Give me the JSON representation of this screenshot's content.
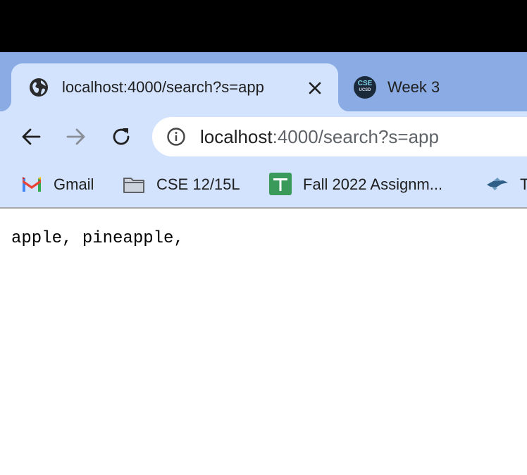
{
  "browser": {
    "tabs": [
      {
        "title": "localhost:4000/search?s=app",
        "active": true,
        "favicon": "globe-icon"
      },
      {
        "title": "Week 3",
        "active": false,
        "favicon_text_top": "CSE",
        "favicon_text_bottom": "UCSD"
      }
    ],
    "toolbar": {
      "url_host": "localhost",
      "url_rest": ":4000/search?s=app"
    },
    "bookmarks": [
      {
        "label": "Gmail",
        "icon": "gmail-icon"
      },
      {
        "label": "CSE 12/15L",
        "icon": "folder-icon"
      },
      {
        "label": "Fall 2022 Assignm...",
        "icon": "sheets-icon"
      },
      {
        "label": "T",
        "icon": "bird-icon"
      }
    ],
    "colors": {
      "tabstrip": "#8aabe4",
      "toolbar": "#d3e3fd",
      "omnibox": "#ffffff"
    }
  },
  "page": {
    "content": "apple, pineapple,"
  }
}
